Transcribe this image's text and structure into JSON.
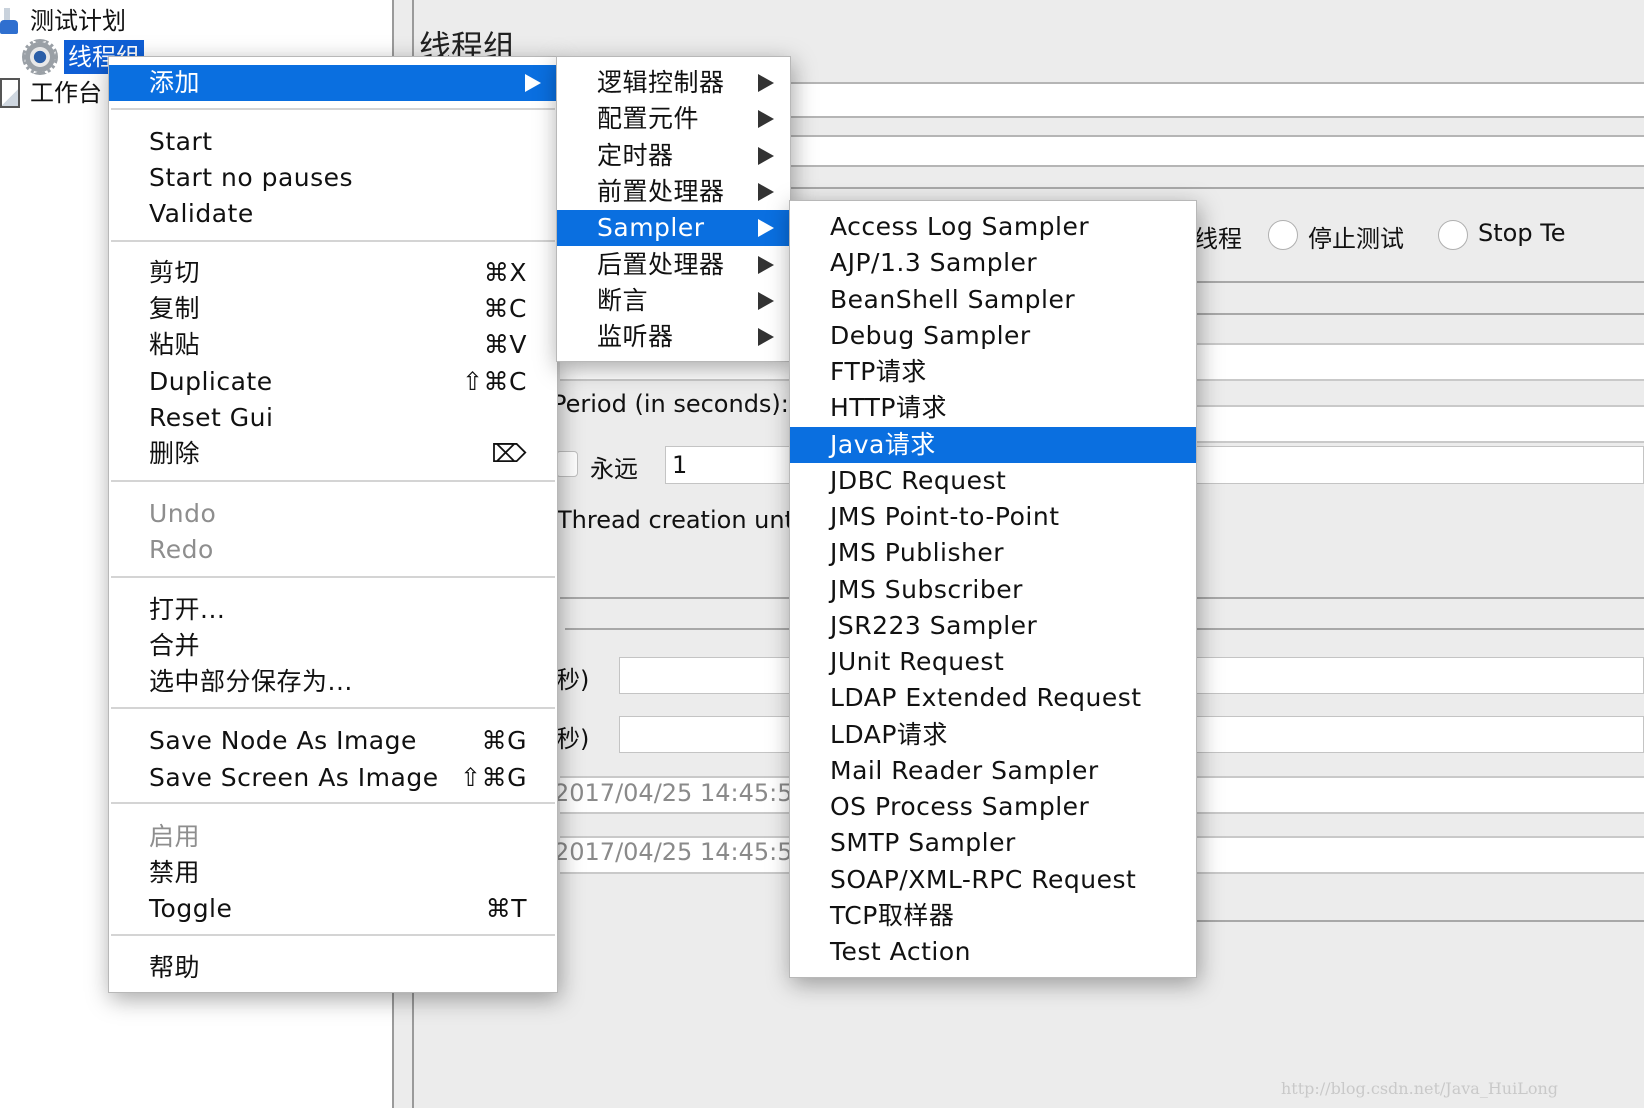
{
  "tree": {
    "nodes": [
      {
        "label": "测试计划",
        "icon": "test-plan-flask-icon"
      },
      {
        "label": "线程组",
        "icon": "thread-group-gear-icon",
        "selected": true
      },
      {
        "label": "工作台",
        "icon": "workbench-icon"
      }
    ]
  },
  "main": {
    "title": "线程组",
    "action_label_fragment": "线程",
    "radio_stop_test": "停止测试",
    "radio_stop_test_now": "Stop Te",
    "ramp_up_label": "Period (in seconds):",
    "forever_label": "永远",
    "loop_count_value": "1",
    "delay_label": "Thread creation unt",
    "duration_label": "秒)",
    "startup_delay_label": "秒)",
    "start_time_value": "2017/04/25 14:45:5",
    "end_time_value": "2017/04/25 14:45:5"
  },
  "context_menu": {
    "add": "添加",
    "start": "Start",
    "start_no_pauses": "Start no pauses",
    "validate": "Validate",
    "cut": "剪切",
    "cut_sc": "⌘X",
    "copy": "复制",
    "copy_sc": "⌘C",
    "paste": "粘贴",
    "paste_sc": "⌘V",
    "duplicate": "Duplicate",
    "duplicate_sc": "⇧⌘C",
    "reset_gui": "Reset Gui",
    "delete": "删除",
    "delete_sc": "⌦",
    "undo": "Undo",
    "redo": "Redo",
    "open": "打开...",
    "merge": "合并",
    "save_selection_as": "选中部分保存为...",
    "save_node_image": "Save Node As Image",
    "save_node_image_sc": "⌘G",
    "save_screen_image": "Save Screen As Image",
    "save_screen_image_sc": "⇧⌘G",
    "enable": "启用",
    "disable": "禁用",
    "toggle": "Toggle",
    "toggle_sc": "⌘T",
    "help": "帮助"
  },
  "add_submenu": {
    "items": [
      "逻辑控制器",
      "配置元件",
      "定时器",
      "前置处理器",
      "Sampler",
      "后置处理器",
      "断言",
      "监听器"
    ],
    "highlighted": "Sampler"
  },
  "sampler_submenu": {
    "items": [
      "Access Log Sampler",
      "AJP/1.3 Sampler",
      "BeanShell Sampler",
      "Debug Sampler",
      "FTP请求",
      "HTTP请求",
      "Java请求",
      "JDBC Request",
      "JMS Point-to-Point",
      "JMS Publisher",
      "JMS Subscriber",
      "JSR223 Sampler",
      "JUnit Request",
      "LDAP Extended Request",
      "LDAP请求",
      "Mail Reader Sampler",
      "OS Process Sampler",
      "SMTP Sampler",
      "SOAP/XML-RPC Request",
      "TCP取样器",
      "Test Action"
    ],
    "highlighted": "Java请求"
  },
  "colors": {
    "highlight": "#0a6fe0",
    "tree_selection": "#0f5fd6"
  },
  "watermark": "http://blog.csdn.net/Java_HuiLong"
}
